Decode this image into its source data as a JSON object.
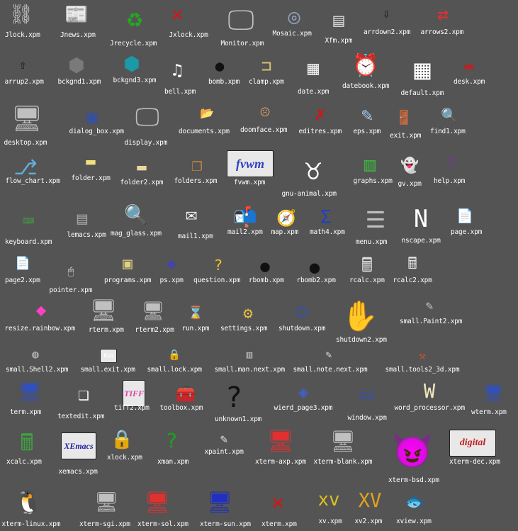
{
  "background": "#545454",
  "icons": [
    {
      "label": "Jlock.xpm",
      "icon": "chain-lock-icon",
      "glyph": "⛓",
      "color": "#c8c8c8"
    },
    {
      "label": "Jnews.xpm",
      "icon": "newspaper-icon",
      "glyph": "📰",
      "color": "#dcdcdc"
    },
    {
      "label": "Jrecycle.xpm",
      "icon": "recycle-icon",
      "glyph": "♻",
      "color": "#22aa22"
    },
    {
      "label": "Jxlock.xpm",
      "icon": "x-chain-lock-icon",
      "glyph": "✕",
      "color": "#e01010"
    },
    {
      "label": "Monitor.xpm",
      "icon": "monitor-icon",
      "glyph": "🖵",
      "color": "#c0c0c0"
    },
    {
      "label": "Mosaic.xpm",
      "icon": "mosaic-icon",
      "glyph": "◎",
      "color": "#8fa0b8"
    },
    {
      "label": "Xfm.xpm",
      "icon": "file-cabinet-icon",
      "glyph": "▤",
      "color": "#d0d0d0"
    },
    {
      "label": "arrdown2.xpm",
      "icon": "arrow-down-icon",
      "glyph": "⇩",
      "color": "#111111"
    },
    {
      "label": "arrows2.xpm",
      "icon": "arrows-swap-icon",
      "glyph": "⇄",
      "color": "#e03030"
    },
    {
      "label": "arrup2.xpm",
      "icon": "arrow-up-icon",
      "glyph": "⇧",
      "color": "#111111"
    },
    {
      "label": "bckgnd1.xpm",
      "icon": "hex-background-gray-icon",
      "glyph": "⬢",
      "color": "#7a7a7a"
    },
    {
      "label": "bckgnd3.xpm",
      "icon": "hex-background-teal-icon",
      "glyph": "⬢",
      "color": "#1a9aa8"
    },
    {
      "label": "bell.xpm",
      "icon": "bell-icon",
      "glyph": "♫",
      "color": "#ffffff"
    },
    {
      "label": "bomb.xpm",
      "icon": "bomb-icon",
      "glyph": "●",
      "color": "#111111"
    },
    {
      "label": "clamp.xpm",
      "icon": "clamp-icon",
      "glyph": "⊐",
      "color": "#d8c070"
    },
    {
      "label": "date.xpm",
      "icon": "calendar-date-icon",
      "glyph": "▦",
      "color": "#e8e8e8"
    },
    {
      "label": "datebook.xpm",
      "icon": "datebook-clock-icon",
      "glyph": "⏰",
      "color": "#3050d0"
    },
    {
      "label": "default.xpm",
      "icon": "grid-default-icon",
      "glyph": "▦",
      "color": "#ffffff"
    },
    {
      "label": "desk.xpm",
      "icon": "desk-icon",
      "glyph": "▬",
      "color": "#c02020"
    },
    {
      "label": "desktop.xpm",
      "icon": "desktop-computer-icon",
      "glyph": "🖥",
      "color": "#c0c0c0"
    },
    {
      "label": "dialog_box.xpm",
      "icon": "dialog-box-icon",
      "glyph": "▣",
      "color": "#3050b0"
    },
    {
      "label": "display.xpm",
      "icon": "display-monitor-icon",
      "glyph": "🖵",
      "color": "#c0c0c0"
    },
    {
      "label": "documents.xpm",
      "icon": "documents-folder-icon",
      "glyph": "📂",
      "color": "#e8d060"
    },
    {
      "label": "doomface.xpm",
      "icon": "doom-face-icon",
      "glyph": "☹",
      "color": "#c89060"
    },
    {
      "label": "editres.xpm",
      "icon": "editres-icon",
      "glyph": "✗",
      "color": "#e01010"
    },
    {
      "label": "eps.xpm",
      "icon": "eps-image-icon",
      "glyph": "✎",
      "color": "#a0c8e8"
    },
    {
      "label": "exit.xpm",
      "icon": "exit-door-icon",
      "glyph": "🚪",
      "color": "#d8c070"
    },
    {
      "label": "find1.xpm",
      "icon": "find-magnifier-icon",
      "glyph": "🔍",
      "color": "#e8e8e8"
    },
    {
      "label": "flow_chart.xpm",
      "icon": "flow-chart-icon",
      "glyph": "⎇",
      "color": "#60b0e0"
    },
    {
      "label": "folder.xpm",
      "icon": "folder-icon",
      "glyph": "▬",
      "color": "#f0e080"
    },
    {
      "label": "folder2.xpm",
      "icon": "folder-tan-icon",
      "glyph": "▬",
      "color": "#e8d8a0"
    },
    {
      "label": "folders.xpm",
      "icon": "folders-icon",
      "glyph": "❐",
      "color": "#c08040"
    },
    {
      "label": "fvwm.xpm",
      "icon": "fvwm-logo-icon",
      "glyph": "fvwm",
      "color": "#3040c0"
    },
    {
      "label": "gnu-animal.xpm",
      "icon": "gnu-head-icon",
      "glyph": "♉",
      "color": "#ffffff"
    },
    {
      "label": "graphs.xpm",
      "icon": "graphs-icon",
      "glyph": "▥",
      "color": "#40b040"
    },
    {
      "label": "gv.xpm",
      "icon": "ghost-icon",
      "glyph": "👻",
      "color": "#ffffff"
    },
    {
      "label": "help.xpm",
      "icon": "help-book-icon",
      "glyph": "?",
      "color": "#8030a0"
    },
    {
      "label": "keyboard.xpm",
      "icon": "keyboard-icon",
      "glyph": "⌨",
      "color": "#40a040"
    },
    {
      "label": "lemacs.xpm",
      "icon": "lemacs-icon",
      "glyph": "▤",
      "color": "#a0a0a0"
    },
    {
      "label": "mag_glass.xpm",
      "icon": "magnifying-glass-icon",
      "glyph": "🔍",
      "color": "#e0e0e0"
    },
    {
      "label": "mail1.xpm",
      "icon": "mail-envelope-icon",
      "glyph": "✉",
      "color": "#f0f0f0"
    },
    {
      "label": "mail2.xpm",
      "icon": "mailbox-icon",
      "glyph": "📬",
      "color": "#c0c0c0"
    },
    {
      "label": "map.xpm",
      "icon": "map-compass-icon",
      "glyph": "🧭",
      "color": "#e04040"
    },
    {
      "label": "math4.xpm",
      "icon": "math-sigma-icon",
      "glyph": "Σ",
      "color": "#2040c0"
    },
    {
      "label": "menu.xpm",
      "icon": "menu-icon",
      "glyph": "☰",
      "color": "#c0c0c0"
    },
    {
      "label": "nscape.xpm",
      "icon": "netscape-logo-icon",
      "glyph": "N",
      "color": "#ffffff"
    },
    {
      "label": "page.xpm",
      "icon": "page-icon",
      "glyph": "📄",
      "color": "#a0c8f0"
    },
    {
      "label": "page2.xpm",
      "icon": "page-lined-icon",
      "glyph": "📄",
      "color": "#f0e0a0"
    },
    {
      "label": "pointer.xpm",
      "icon": "pointer-mouse-icon",
      "glyph": "🖱",
      "color": "#e0e0e0"
    },
    {
      "label": "programs.xpm",
      "icon": "programs-icon",
      "glyph": "▣",
      "color": "#e0d080"
    },
    {
      "label": "ps.xpm",
      "icon": "postscript-icon",
      "glyph": "◈",
      "color": "#4040c0"
    },
    {
      "label": "question.xpm",
      "icon": "question-mark-icon",
      "glyph": "?",
      "color": "#f0c020"
    },
    {
      "label": "rbomb.xpm",
      "icon": "red-bomb-icon",
      "glyph": "●",
      "color": "#111111"
    },
    {
      "label": "rbomb2.xpm",
      "icon": "red-bomb-two-icon",
      "glyph": "●",
      "color": "#111111"
    },
    {
      "label": "rcalc.xpm",
      "icon": "calculator-hand-icon",
      "glyph": "🖩",
      "color": "#e0e0e0"
    },
    {
      "label": "rcalc2.xpm",
      "icon": "calculator-icon",
      "glyph": "🖩",
      "color": "#e0e0e0"
    },
    {
      "label": "resize.rainbow.xpm",
      "icon": "rainbow-resize-icon",
      "glyph": "◆",
      "color": "#ff40c0"
    },
    {
      "label": "rterm.xpm",
      "icon": "remote-terminal-icon",
      "glyph": "🖥",
      "color": "#c0c0c0"
    },
    {
      "label": "rterm2.xpm",
      "icon": "remote-terminal-two-icon",
      "glyph": "🖥",
      "color": "#c0c0c0"
    },
    {
      "label": "run.xpm",
      "icon": "run-icon",
      "glyph": "⌛",
      "color": "#d04040"
    },
    {
      "label": "settings.xpm",
      "icon": "settings-icon",
      "glyph": "⚙",
      "color": "#e0c040"
    },
    {
      "label": "shutdown.xpm",
      "icon": "shutdown-icon",
      "glyph": "⏻",
      "color": "#3050c0"
    },
    {
      "label": "shutdown2.xpm",
      "icon": "shutdown-hand-icon",
      "glyph": "✋",
      "color": "#e0c090"
    },
    {
      "label": "small.Paint2.xpm",
      "icon": "paint-icon",
      "glyph": "✎",
      "color": "#c0c0c0"
    },
    {
      "label": "small.Shell2.xpm",
      "icon": "shell-icon",
      "glyph": "◍",
      "color": "#c0c0c0"
    },
    {
      "label": "small.exit.xpm",
      "icon": "exit-small-icon",
      "glyph": "Exit",
      "color": "#ffffff"
    },
    {
      "label": "small.lock.xpm",
      "icon": "lock-small-icon",
      "glyph": "🔒",
      "color": "#c0c0c0"
    },
    {
      "label": "small.man.next.xpm",
      "icon": "man-pages-icon",
      "glyph": "▥",
      "color": "#c0c0c0"
    },
    {
      "label": "small.note.next.xpm",
      "icon": "note-small-icon",
      "glyph": "✎",
      "color": "#e0e0e0"
    },
    {
      "label": "small.tools2_3d.xpm",
      "icon": "tools-icon",
      "glyph": "⚒",
      "color": "#c05030"
    },
    {
      "label": "term.xpm",
      "icon": "terminal-icon",
      "glyph": "🖥",
      "color": "#3050c0"
    },
    {
      "label": "textedit.xpm",
      "icon": "textedit-pages-icon",
      "glyph": "❏",
      "color": "#ffffff"
    },
    {
      "label": "tiff2.xpm",
      "icon": "tiff-image-icon",
      "glyph": "TIFF",
      "color": "#e040a0"
    },
    {
      "label": "toolbox.xpm",
      "icon": "toolbox-icon",
      "glyph": "🧰",
      "color": "#d09090"
    },
    {
      "label": "unknown1.xpm",
      "icon": "unknown-question-icon",
      "glyph": "?",
      "color": "#111111"
    },
    {
      "label": "wierd_page3.xpm",
      "icon": "weird-page-icon",
      "glyph": "◈",
      "color": "#4060d0"
    },
    {
      "label": "window.xpm",
      "icon": "window-icon",
      "glyph": "▭",
      "color": "#3050c0"
    },
    {
      "label": "word_processor.xpm",
      "icon": "word-processor-icon",
      "glyph": "W",
      "color": "#f0e8c0"
    },
    {
      "label": "wterm.xpm",
      "icon": "wterm-icon",
      "glyph": "🖥",
      "color": "#3050c0"
    },
    {
      "label": "xcalc.xpm",
      "icon": "xcalc-hand-icon",
      "glyph": "🖩",
      "color": "#40a040"
    },
    {
      "label": "xemacs.xpm",
      "icon": "xemacs-icon",
      "glyph": "XEmacs",
      "color": "#2020a0"
    },
    {
      "label": "xlock.xpm",
      "icon": "padlock-icon",
      "glyph": "🔒",
      "color": "#a0a0a0"
    },
    {
      "label": "xman.xpm",
      "icon": "xman-book-icon",
      "glyph": "?",
      "color": "#20a020"
    },
    {
      "label": "xpaint.xpm",
      "icon": "xpaint-icon",
      "glyph": "✎",
      "color": "#e0e0e0"
    },
    {
      "label": "xterm-axp.xpm",
      "icon": "xterm-axp-icon",
      "glyph": "🖥",
      "color": "#e03030"
    },
    {
      "label": "xterm-blank.xpm",
      "icon": "xterm-blank-icon",
      "glyph": "🖥",
      "color": "#c0c0c0"
    },
    {
      "label": "xterm-bsd.xpm",
      "icon": "bsd-daemon-icon",
      "glyph": "😈",
      "color": "#3050c0"
    },
    {
      "label": "xterm-dec.xpm",
      "icon": "xterm-dec-icon",
      "glyph": "digital",
      "color": "#c02020"
    },
    {
      "label": "xterm-linux.xpm",
      "icon": "linux-tux-icon",
      "glyph": "🐧",
      "color": "#ffffff"
    },
    {
      "label": "xterm-sgi.xpm",
      "icon": "xterm-sgi-icon",
      "glyph": "🖥",
      "color": "#c0c0c0"
    },
    {
      "label": "xterm-sol.xpm",
      "icon": "xterm-solaris-icon",
      "glyph": "🖥",
      "color": "#e03030"
    },
    {
      "label": "xterm-sun.xpm",
      "icon": "xterm-sun-icon",
      "glyph": "🖥",
      "color": "#2030c0"
    },
    {
      "label": "xterm.xpm",
      "icon": "xterm-x-icon",
      "glyph": "✕",
      "color": "#e01010"
    },
    {
      "label": "xv.xpm",
      "icon": "xv-logo-icon",
      "glyph": "xv",
      "color": "#e0c020"
    },
    {
      "label": "xv2.xpm",
      "icon": "xv-two-logo-icon",
      "glyph": "XV",
      "color": "#e0a020"
    },
    {
      "label": "xview.xpm",
      "icon": "xview-fish-icon",
      "glyph": "🐟",
      "color": "#e02020"
    }
  ]
}
